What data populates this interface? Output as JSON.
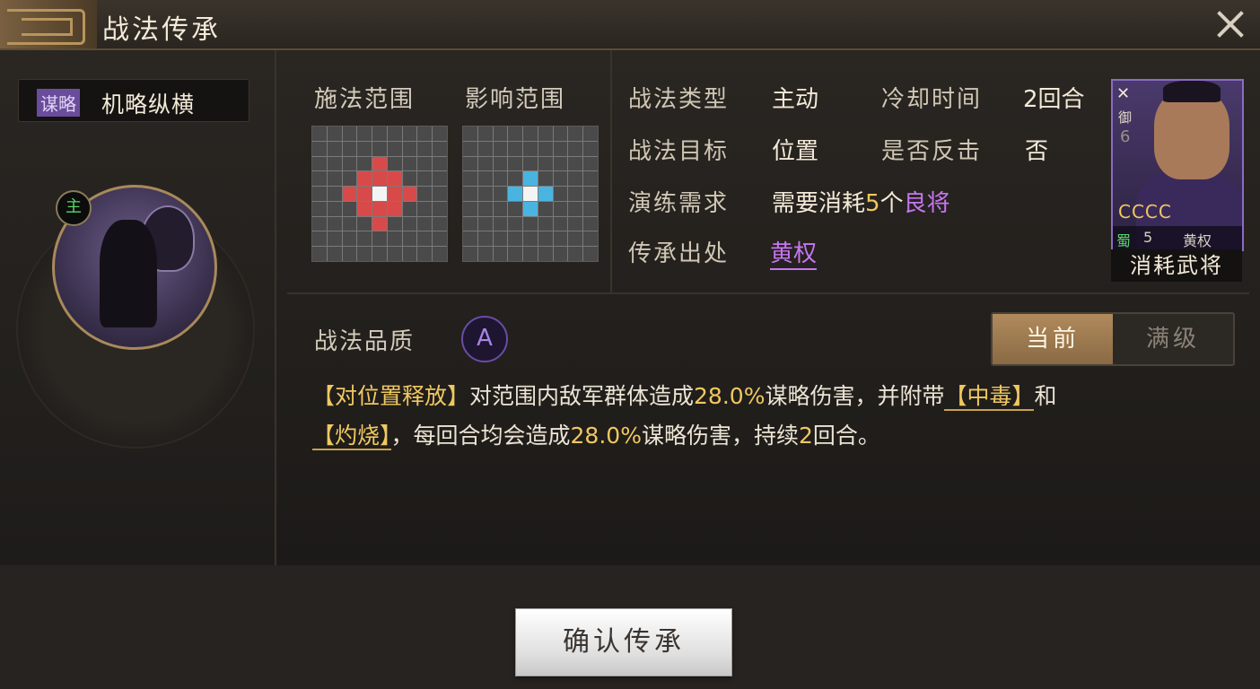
{
  "title": "战法传承",
  "skill": {
    "type_tag": "谋略",
    "name": "机略纵横",
    "main_badge": "主"
  },
  "range": {
    "cast_label": "施法范围",
    "effect_label": "影响范围"
  },
  "info": {
    "type_label": "战法类型",
    "type_value": "主动",
    "cooldown_label": "冷却时间",
    "cooldown_value": "2回合",
    "target_label": "战法目标",
    "target_value": "位置",
    "counter_label": "是否反击",
    "counter_value": "否",
    "train_label": "演练需求",
    "train_prefix": "需要消耗",
    "train_count": "5",
    "train_mid": "个",
    "train_item": "良将",
    "source_label": "传承出处",
    "source_value": "黄权"
  },
  "card": {
    "arms_icon": "crossed-spear-icon",
    "troop_type": "御",
    "level": "6",
    "stars": "CCCC",
    "faction": "蜀",
    "cost": "5",
    "general_name": "黄权",
    "caption": "消耗武将"
  },
  "quality": {
    "label": "战法品质",
    "grade": "A"
  },
  "toggle": {
    "current": "当前",
    "max": "满级"
  },
  "desc": {
    "t1": "【对位置释放】",
    "t2": "对范围内敌军群体造成",
    "p1": "28.0%",
    "t3": "谋略伤害，并附带",
    "s1": "【中毒】",
    "t4": "和",
    "s2": "【灼烧】",
    "t5": "，每回合均会造成",
    "p2": "28.0%",
    "t6": "谋略伤害，持续",
    "n1": "2",
    "t7": "回合。"
  },
  "confirm_label": "确认传承",
  "colors": {
    "accent_gold": "#f0c860",
    "accent_purple": "#c676f0",
    "cast_red": "#d84a4a",
    "effect_blue": "#4ab4e0"
  }
}
